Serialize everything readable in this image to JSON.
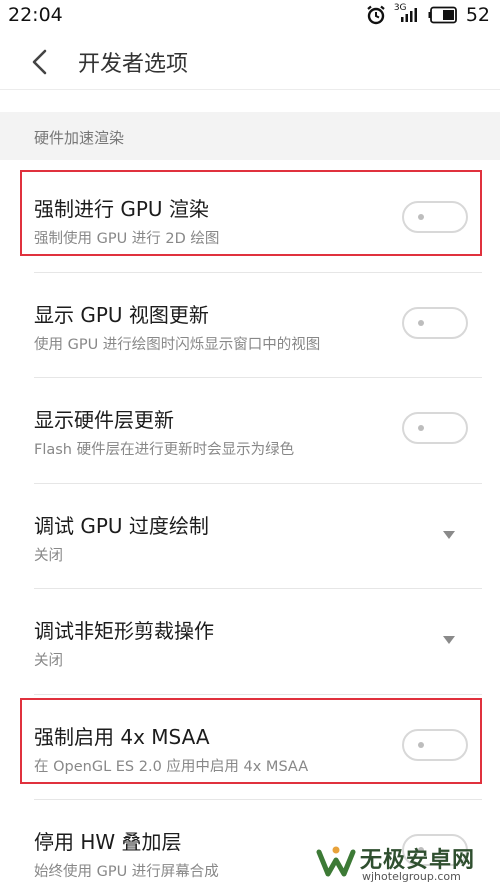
{
  "status_bar": {
    "time": "22:04",
    "network_type": "3G",
    "battery_level": "52"
  },
  "header": {
    "title": "开发者选项",
    "back_icon": "chevron-left-icon"
  },
  "section": {
    "label": "硬件加速渲染"
  },
  "settings": [
    {
      "title": "强制进行 GPU 渲染",
      "subtitle": "强制使用 GPU 进行 2D 绘图",
      "control": "toggle",
      "on": false,
      "highlighted": true
    },
    {
      "title": "显示 GPU 视图更新",
      "subtitle": "使用 GPU 进行绘图时闪烁显示窗口中的视图",
      "control": "toggle",
      "on": false,
      "highlighted": false
    },
    {
      "title": "显示硬件层更新",
      "subtitle": "Flash 硬件层在进行更新时会显示为绿色",
      "control": "toggle",
      "on": false,
      "highlighted": false
    },
    {
      "title": "调试 GPU 过度绘制",
      "subtitle": "关闭",
      "control": "dropdown",
      "highlighted": false
    },
    {
      "title": "调试非矩形剪裁操作",
      "subtitle": "关闭",
      "control": "dropdown",
      "highlighted": false
    },
    {
      "title": "强制启用 4x MSAA",
      "subtitle": "在 OpenGL ES 2.0 应用中启用 4x MSAA",
      "control": "toggle",
      "on": false,
      "highlighted": true
    },
    {
      "title": "停用 HW 叠加层",
      "subtitle": "始终使用 GPU 进行屏幕合成",
      "control": "toggle",
      "on": false,
      "highlighted": false
    }
  ],
  "highlight_color": "#e0313d",
  "watermark": {
    "title": "无极安卓网",
    "url": "wjhotelgroup.com"
  }
}
